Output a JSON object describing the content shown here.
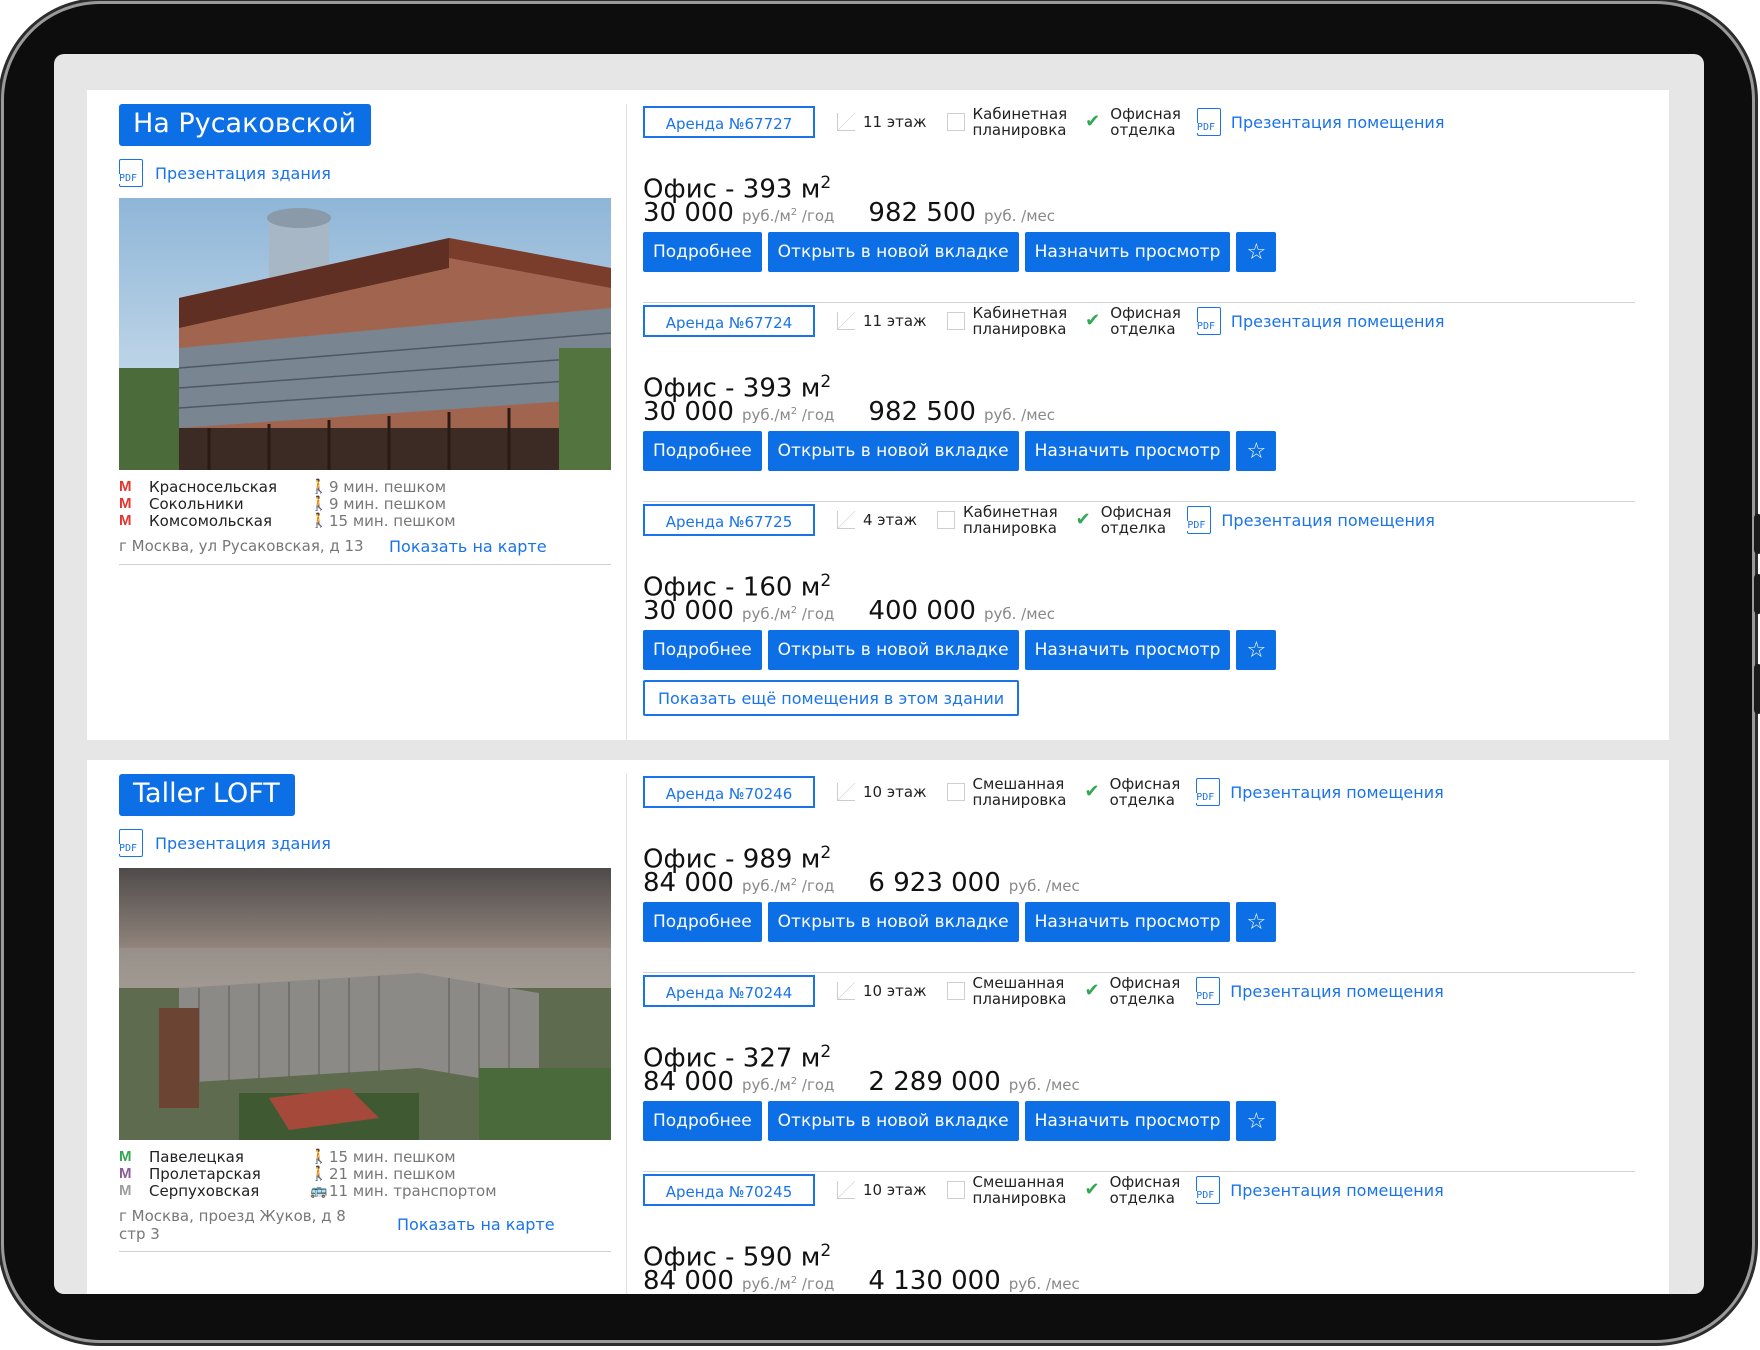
{
  "buildings": [
    {
      "name": "На Русаковской",
      "presentation_label": "Презентация здания",
      "metro": [
        {
          "station": "Красносельская",
          "time": "9 мин. пешком",
          "line_color": "red",
          "mode": "walk"
        },
        {
          "station": "Сокольники",
          "time": "9 мин. пешком",
          "line_color": "red",
          "mode": "walk"
        },
        {
          "station": "Комсомольская",
          "time": "15 мин. пешком",
          "line_color": "red",
          "mode": "walk"
        }
      ],
      "address": "г Москва, ул Русаковская, д 13",
      "map_link": "Показать на карте",
      "more_button": "Показать ещё помещения в этом здании",
      "offers": [
        {
          "id": "Аренда №67727",
          "floor": "11 этаж",
          "layout": [
            "Кабинетная",
            "планировка"
          ],
          "finish": [
            "Офисная",
            "отделка"
          ],
          "presentation": "Презентация помещения",
          "title": "Офис - 393 м",
          "price_m2": "30 000",
          "price_month": "982 500"
        },
        {
          "id": "Аренда №67724",
          "floor": "11 этаж",
          "layout": [
            "Кабинетная",
            "планировка"
          ],
          "finish": [
            "Офисная",
            "отделка"
          ],
          "presentation": "Презентация помещения",
          "title": "Офис - 393 м",
          "price_m2": "30 000",
          "price_month": "982 500"
        },
        {
          "id": "Аренда №67725",
          "floor": "4 этаж",
          "layout": [
            "Кабинетная",
            "планировка"
          ],
          "finish": [
            "Офисная",
            "отделка"
          ],
          "presentation": "Презентация помещения",
          "title": "Офис - 160 м",
          "price_m2": "30 000",
          "price_month": "400 000"
        }
      ]
    },
    {
      "name": "Taller LOFT",
      "presentation_label": "Презентация здания",
      "metro": [
        {
          "station": "Павелецкая",
          "time": "15 мин. пешком",
          "line_color": "green",
          "mode": "walk"
        },
        {
          "station": "Пролетарская",
          "time": "21 мин. пешком",
          "line_color": "purple",
          "mode": "walk"
        },
        {
          "station": "Серпуховская",
          "time": "11 мин. транспортом",
          "line_color": "gray",
          "mode": "transport"
        }
      ],
      "address_lines": [
        "г Москва, проезд Жуков, д 8",
        "стр 3"
      ],
      "map_link": "Показать на карте",
      "offers": [
        {
          "id": "Аренда №70246",
          "floor": "10 этаж",
          "layout": [
            "Смешанная",
            "планировка"
          ],
          "finish": [
            "Офисная",
            "отделка"
          ],
          "presentation": "Презентация помещения",
          "title": "Офис - 989 м",
          "price_m2": "84 000",
          "price_month": "6 923 000"
        },
        {
          "id": "Аренда №70244",
          "floor": "10 этаж",
          "layout": [
            "Смешанная",
            "планировка"
          ],
          "finish": [
            "Офисная",
            "отделка"
          ],
          "presentation": "Презентация помещения",
          "title": "Офис - 327 м",
          "price_m2": "84 000",
          "price_month": "2 289 000"
        },
        {
          "id": "Аренда №70245",
          "floor": "10 этаж",
          "layout": [
            "Смешанная",
            "планировка"
          ],
          "finish": [
            "Офисная",
            "отделка"
          ],
          "presentation": "Презентация помещения",
          "title": "Офис - 590 м",
          "price_m2": "84 000",
          "price_month": "4 130 000"
        }
      ]
    }
  ],
  "labels": {
    "area_unit_sup": "2",
    "per_m2_year": "руб./м",
    "per_m2_year_sup": "2",
    "per_m2_year_tail": " /год",
    "per_month": "руб. /мес",
    "btn_details": "Подробнее",
    "btn_new_tab": "Открыть в новой вкладке",
    "btn_viewing": "Назначить просмотр",
    "pdf": "PDF",
    "star": "☆"
  },
  "colors": {
    "accent": "#0d6fe6",
    "link": "#1a73e8",
    "metro_red": "#e5352c",
    "metro_green": "#33a853",
    "metro_purple": "#8d5b95",
    "check": "#33a853"
  },
  "icons": {
    "pdf": "pdf-icon",
    "floor": "floor-icon",
    "layout": "layout-icon",
    "finish": "check-icon",
    "favorite": "star-icon",
    "metro": "metro-icon",
    "walk": "walk-icon",
    "transport": "bus-icon"
  }
}
